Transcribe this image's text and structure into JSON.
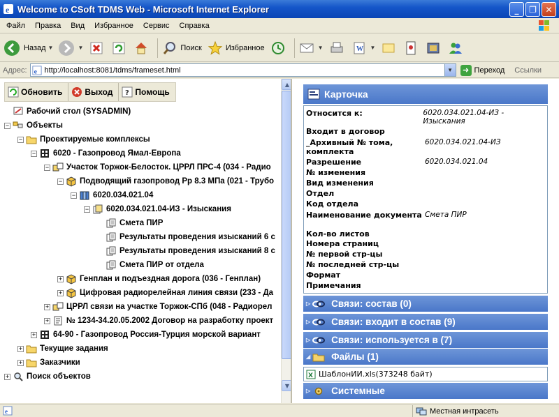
{
  "window": {
    "title": "Welcome to CSoft TDMS Web - Microsoft Internet Explorer"
  },
  "menu": [
    "Файл",
    "Правка",
    "Вид",
    "Избранное",
    "Сервис",
    "Справка"
  ],
  "toolbar": {
    "back_label": "Назад",
    "search_label": "Поиск",
    "favorites_label": "Избранное"
  },
  "address": {
    "label": "Адрес:",
    "url": "http://localhost:8081/tdms/frameset.html",
    "go_label": "Переход",
    "links_label": "Ссылки"
  },
  "left_toolbar": {
    "refresh": "Обновить",
    "exit": "Выход",
    "help": "Помощь"
  },
  "tree": [
    {
      "label": "Рабочий стол (SYSADMIN)",
      "icon": "desktop-icon"
    },
    {
      "label": "Объекты",
      "icon": "objects-icon"
    },
    {
      "label": "Проектируемые комплексы",
      "icon": "folder-icon"
    },
    {
      "label": "6020 - Газопровод Ямал-Европа",
      "icon": "building-icon"
    },
    {
      "label": "Участок Торжок-Белосток. ЦРРЛ ПРС-4 (034 - Радио",
      "icon": "section-icon"
    },
    {
      "label": "Подводящий газопровод Рр 8.3 МПа (021 - Трубо",
      "icon": "cube-icon"
    },
    {
      "label": "6020.034.021.04",
      "icon": "stack-icon"
    },
    {
      "label": "6020.034.021.04-ИЗ - Изыскания",
      "icon": "docset-icon"
    },
    {
      "label": "Смета ПИР",
      "icon": "doc-icon"
    },
    {
      "label": "Результаты проведения изысканий 6 с",
      "icon": "doc-icon"
    },
    {
      "label": "Результаты проведения изысканий 8 с",
      "icon": "doc-icon"
    },
    {
      "label": "Смета ПИР от отдела",
      "icon": "doc-icon"
    },
    {
      "label": "Генплан и подъездная дорога (036 - Генплан)",
      "icon": "cube-icon"
    },
    {
      "label": "Цифровая радиорелейная линия связи (233 - Да",
      "icon": "cube-icon"
    },
    {
      "label": "ЦРРЛ связи на участке Торжок-СПб (048 - Радиорел",
      "icon": "section-icon"
    },
    {
      "label": "№ 1234-34.20.05.2002 Договор на разработку проект",
      "icon": "contract-icon"
    },
    {
      "label": "64-90 - Газопровод Россия-Турция морской вариант",
      "icon": "building-icon"
    },
    {
      "label": "Текущие задания",
      "icon": "folder-icon"
    },
    {
      "label": "Заказчики",
      "icon": "folder-icon"
    },
    {
      "label": "Поиск объектов",
      "icon": "search-icon"
    }
  ],
  "card": {
    "title": "Карточка",
    "rows": [
      {
        "key": "Относится к:",
        "value": "6020.034.021.04-ИЗ - Изыскания"
      },
      {
        "key": "Входит в договор",
        "value": ""
      },
      {
        "key": "_Архивный № тома, комплекта",
        "value": "6020.034.021.04-ИЗ"
      },
      {
        "key": "Разрешение",
        "value": "6020.034.021.04"
      },
      {
        "key": "№ изменения",
        "value": ""
      },
      {
        "key": "Вид изменения",
        "value": ""
      },
      {
        "key": "Отдел",
        "value": ""
      },
      {
        "key": "Код отдела",
        "value": ""
      },
      {
        "key": "Наименование документа",
        "value": "Смета ПИР"
      },
      {
        "key": "Кол-во листов",
        "value": ""
      },
      {
        "key": "Номера страниц",
        "value": ""
      },
      {
        "key": "№ первой стр-цы",
        "value": ""
      },
      {
        "key": "№ последней стр-цы",
        "value": ""
      },
      {
        "key": "Формат",
        "value": ""
      },
      {
        "key": "Примечания",
        "value": ""
      }
    ]
  },
  "sections": {
    "links_composition": "Связи: состав (0)",
    "links_included": "Связи: входит в состав (9)",
    "links_used": "Связи: используется в (7)",
    "files": "Файлы (1)",
    "system": "Системные"
  },
  "files": [
    {
      "name": "ШаблонИИ.xls(373248 байт)"
    }
  ],
  "status": {
    "zone": "Местная интрасеть"
  }
}
